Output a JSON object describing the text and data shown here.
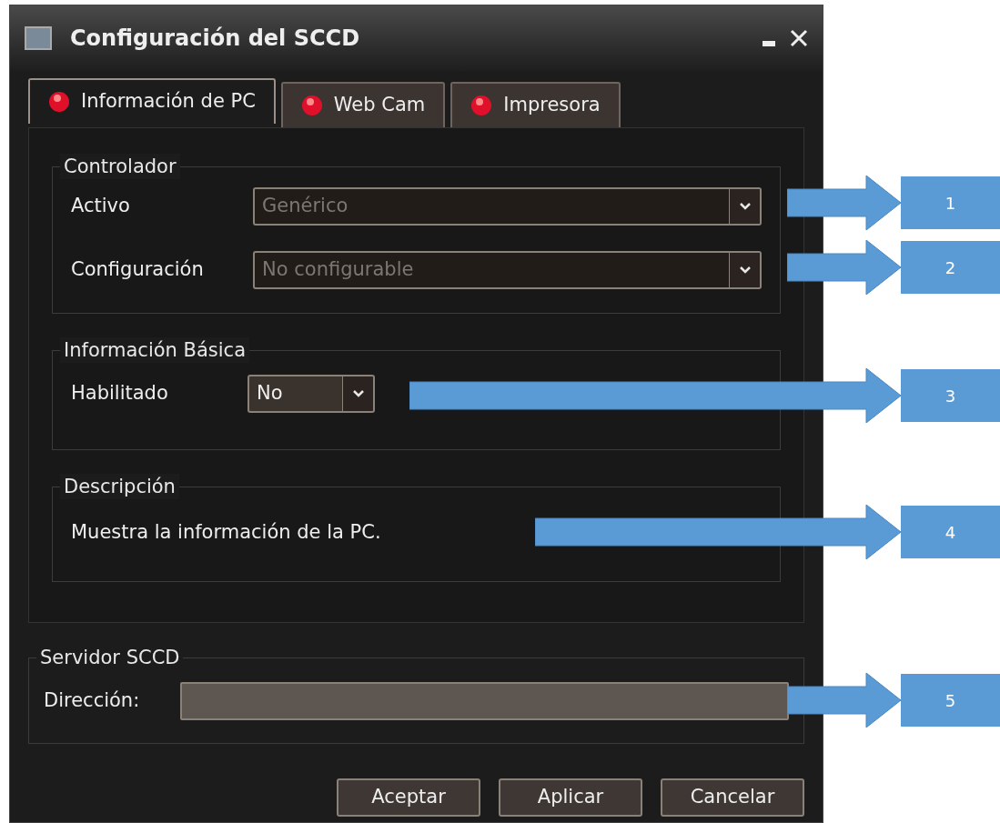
{
  "window": {
    "title": "Configuración del SCCD"
  },
  "tabs": [
    {
      "label": "Información de PC",
      "selected": true
    },
    {
      "label": "Web Cam",
      "selected": false
    },
    {
      "label": "Impresora",
      "selected": false
    }
  ],
  "controlador": {
    "title": "Controlador",
    "rows": [
      {
        "label": "Activo",
        "value": "Genérico",
        "disabled": true
      },
      {
        "label": "Configuración",
        "value": "No configurable",
        "disabled": true
      }
    ]
  },
  "informacion_basica": {
    "title": "Información Básica",
    "label": "Habilitado",
    "value": "No",
    "disabled": false
  },
  "descripcion": {
    "title": "Descripción",
    "text": "Muestra la información de la PC."
  },
  "servidor": {
    "title": "Servidor SCCD",
    "label": "Dirección:"
  },
  "buttons": [
    "Aceptar",
    "Aplicar",
    "Cancelar"
  ],
  "callouts": [
    {
      "label": "1"
    },
    {
      "label": "2"
    },
    {
      "label": "3"
    },
    {
      "label": "4"
    },
    {
      "label": "5"
    }
  ]
}
